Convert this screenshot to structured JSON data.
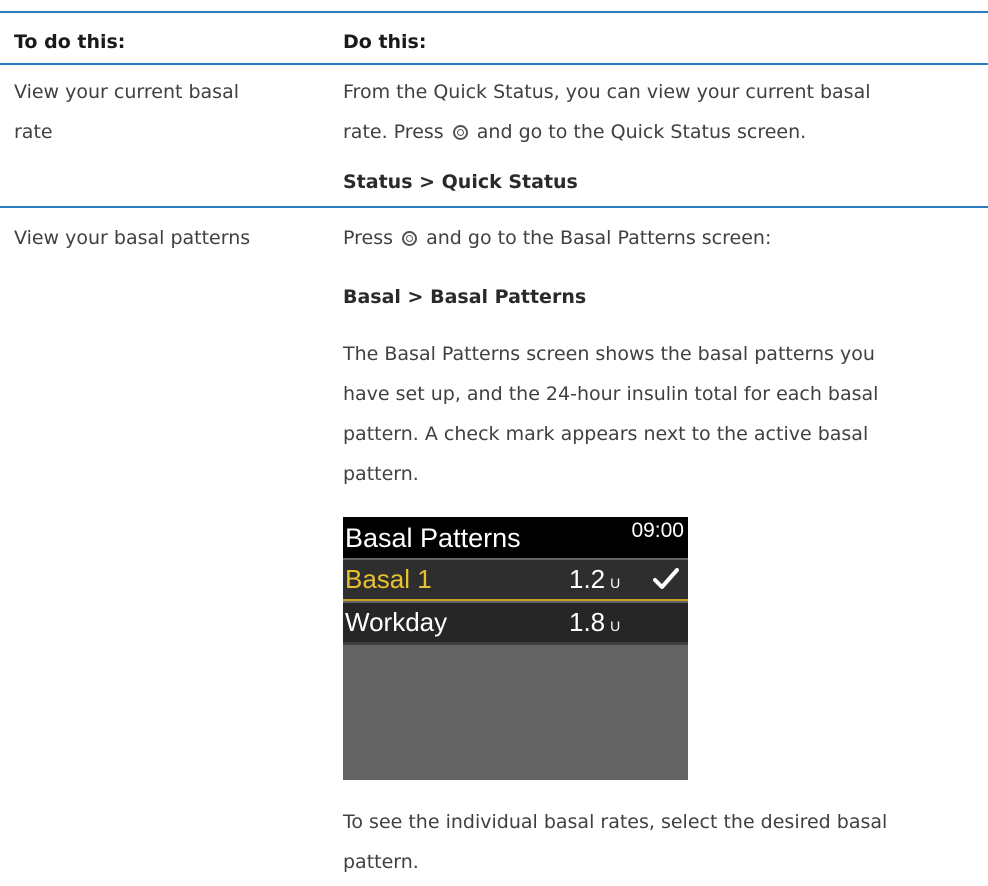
{
  "table": {
    "header": {
      "col1": "To do this:",
      "col2": "Do this:"
    },
    "row1": {
      "task_line1": "View your current basal",
      "task_line2": "rate",
      "desc_line1": "From the Quick Status, you can view your current basal",
      "desc_line2_pre": "rate. Press",
      "desc_line2_post": "and go to the Quick Status screen.",
      "path": "Status > Quick Status"
    },
    "row2": {
      "task": "View your basal patterns",
      "instr_pre": "Press",
      "instr_post": "and go to the Basal Patterns screen:",
      "path": "Basal > Basal Patterns",
      "para_line1": "The Basal Patterns screen shows the basal patterns you",
      "para_line2": "have set up, and the 24-hour insulin total for each basal",
      "para_line3": "pattern. A check mark appears next to the active basal",
      "para_line4": "pattern.",
      "after_line1": "To see the individual basal rates, select the desired basal",
      "after_line2": "pattern."
    }
  },
  "device_screen": {
    "title": "Basal Patterns",
    "time": "09:00",
    "patterns": [
      {
        "name": "Basal 1",
        "value": "1.2",
        "unit": "U",
        "active": true
      },
      {
        "name": "Workday",
        "value": "1.8",
        "unit": "U",
        "active": false
      }
    ],
    "colors": {
      "highlight": "#e8c12e",
      "background": "#636363",
      "header": "#000000"
    }
  },
  "icons": {
    "select_button": "select-button-icon",
    "check": "checkmark-icon"
  },
  "colors": {
    "rule": "#2a7bbf"
  }
}
